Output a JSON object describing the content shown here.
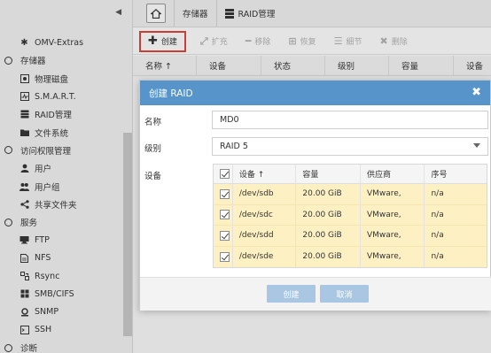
{
  "sidebar": {
    "items": [
      {
        "label": "OMV-Extras",
        "icon": "puzzle-icon",
        "type": "child"
      },
      {
        "label": "存储器",
        "icon": "circle-icon",
        "type": "group"
      },
      {
        "label": "物理磁盘",
        "icon": "disk-icon",
        "type": "child"
      },
      {
        "label": "S.M.A.R.T.",
        "icon": "smart-icon",
        "type": "child"
      },
      {
        "label": "RAID管理",
        "icon": "database-icon",
        "type": "child"
      },
      {
        "label": "文件系统",
        "icon": "folder-icon",
        "type": "child"
      },
      {
        "label": "访问权限管理",
        "icon": "circle-icon",
        "type": "group"
      },
      {
        "label": "用户",
        "icon": "user-icon",
        "type": "child"
      },
      {
        "label": "用户组",
        "icon": "users-icon",
        "type": "child"
      },
      {
        "label": "共享文件夹",
        "icon": "share-icon",
        "type": "child"
      },
      {
        "label": "服务",
        "icon": "circle-icon",
        "type": "group"
      },
      {
        "label": "FTP",
        "icon": "ftp-icon",
        "type": "child"
      },
      {
        "label": "NFS",
        "icon": "file-icon",
        "type": "child"
      },
      {
        "label": "Rsync",
        "icon": "sync-icon",
        "type": "child"
      },
      {
        "label": "SMB/CIFS",
        "icon": "windows-icon",
        "type": "child"
      },
      {
        "label": "SNMP",
        "icon": "network-icon",
        "type": "child"
      },
      {
        "label": "SSH",
        "icon": "terminal-icon",
        "type": "child"
      },
      {
        "label": "诊断",
        "icon": "circle-icon",
        "type": "group"
      }
    ]
  },
  "breadcrumb": {
    "storage": "存储器",
    "raid": "RAID管理"
  },
  "toolbar": {
    "create": "创建",
    "grow": "扩充",
    "remove": "移除",
    "recover": "恢复",
    "detail": "细节",
    "delete": "删除"
  },
  "grid": {
    "columns": [
      "名称 ↑",
      "设备",
      "状态",
      "级别",
      "容量",
      "设备"
    ]
  },
  "modal": {
    "title": "创建 RAID",
    "name_label": "名称",
    "name_value": "MD0",
    "level_label": "级别",
    "level_value": "RAID 5",
    "devices_label": "设备",
    "table": {
      "headers": {
        "device": "设备 ↑",
        "capacity": "容量",
        "vendor": "供应商",
        "serial": "序号"
      },
      "rows": [
        {
          "device": "/dev/sdb",
          "capacity": "20.00 GiB",
          "vendor": "VMware,",
          "serial": "n/a"
        },
        {
          "device": "/dev/sdc",
          "capacity": "20.00 GiB",
          "vendor": "VMware,",
          "serial": "n/a"
        },
        {
          "device": "/dev/sdd",
          "capacity": "20.00 GiB",
          "vendor": "VMware,",
          "serial": "n/a"
        },
        {
          "device": "/dev/sde",
          "capacity": "20.00 GiB",
          "vendor": "VMware,",
          "serial": "n/a"
        }
      ]
    },
    "create_button": "创建",
    "cancel_button": "取消"
  },
  "colors": {
    "modal_header": "#5794c9",
    "selected_row": "#fdf1c4",
    "create_highlight": "#e0443c",
    "footer_button": "#a9c7e2"
  }
}
